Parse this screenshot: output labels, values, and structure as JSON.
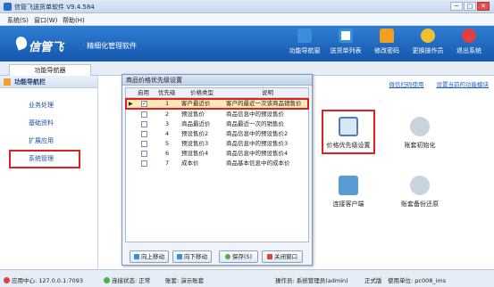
{
  "window": {
    "title": "信管飞送货单软件 V9.4.584",
    "minimize": "─",
    "maximize": "□",
    "close": "✕"
  },
  "menu": [
    "系统(S)",
    "窗口(W)",
    "帮助(H)"
  ],
  "banner": {
    "logo": "信管飞",
    "slogan_dot": "·",
    "slogan": "精细化管理软件",
    "tools": [
      {
        "label": "功能导航窗",
        "icon": "monitor-icon",
        "color": "#3a8fd8"
      },
      {
        "label": "送货单列表",
        "icon": "list-icon",
        "color": "#3a8fd8"
      },
      {
        "label": "修改密码",
        "icon": "lock-icon",
        "color": "#f0a020"
      },
      {
        "label": "更换操作员",
        "icon": "users-icon",
        "color": "#f0c030"
      },
      {
        "label": "退出系统",
        "icon": "exit-icon",
        "color": "#e04040"
      }
    ]
  },
  "tab": {
    "label": "功能导航器"
  },
  "sidebar": {
    "title": "功能导航栏",
    "items": [
      {
        "label": "业务处理"
      },
      {
        "label": "基础资料"
      },
      {
        "label": "扩展应用"
      },
      {
        "label": "系统管理"
      }
    ]
  },
  "main": {
    "links": [
      "微信扫码使用",
      "设置当前的功能模块"
    ],
    "functions": [
      {
        "label": "价格优先级设置",
        "icon": "price-priority-icon"
      },
      {
        "label": "账套初始化",
        "icon": "init-icon"
      },
      {
        "label": "连接客户端",
        "icon": "client-icon"
      },
      {
        "label": "账套备份还原",
        "icon": "backup-icon"
      }
    ]
  },
  "dialog": {
    "title": "商品价格优先级设置",
    "columns": [
      "启用",
      "优先级",
      "价格类型",
      "说明"
    ],
    "rows": [
      {
        "enabled": "✓",
        "priority": "1",
        "type": "客户最近价",
        "desc": "客户的最近一次该商品销售价"
      },
      {
        "enabled": "",
        "priority": "2",
        "type": "预设售价",
        "desc": "商品信息中的预设售价"
      },
      {
        "enabled": "",
        "priority": "3",
        "type": "商品最近价",
        "desc": "商品最近一次的销售价"
      },
      {
        "enabled": "",
        "priority": "4",
        "type": "预设售价2",
        "desc": "商品信息中的预设售价2"
      },
      {
        "enabled": "",
        "priority": "5",
        "type": "预设售价3",
        "desc": "商品信息中的预设售价3"
      },
      {
        "enabled": "",
        "priority": "6",
        "type": "预设售价4",
        "desc": "商品信息中的预设售价4"
      },
      {
        "enabled": "",
        "priority": "7",
        "type": "成本价",
        "desc": "商品基本信息中的成本价"
      }
    ],
    "buttons": {
      "up": "向上移动",
      "down": "向下移动",
      "save": "保存(S)",
      "close": "关闭窗口"
    }
  },
  "status": {
    "server": "应用中心: 127.0.0.1:7093",
    "connection": "连接状态: 正常",
    "account": "账套: 演示账套",
    "operator": "操作员: 系统管理员(admin)",
    "version": "正式版",
    "unit": "使用单位: pc008_ims"
  }
}
